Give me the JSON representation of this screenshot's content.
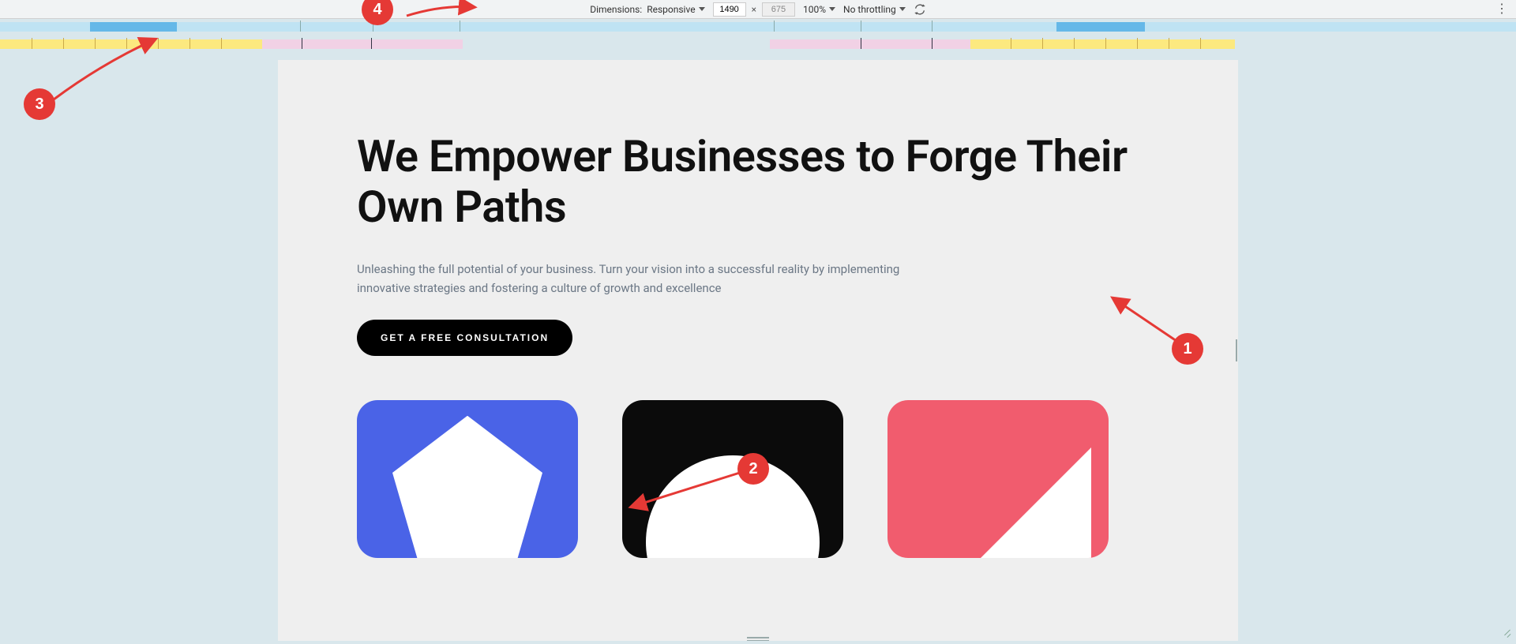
{
  "toolbar": {
    "dimensions_label": "Dimensions:",
    "dimensions_mode": "Responsive",
    "width": "1490",
    "height": "675",
    "zoom": "100%",
    "throttling": "No throttling"
  },
  "hero": {
    "title": "We Empower Businesses to Forge Their Own Paths",
    "subtitle": "Unleashing the full potential of your business. Turn your vision into a successful reality by implementing innovative strategies and fostering a culture of growth and excellence",
    "cta_label": "GET A FREE CONSULTATION"
  },
  "annotations": {
    "n1": "1",
    "n2": "2",
    "n3": "3",
    "n4": "4"
  },
  "cards": {
    "colors": {
      "blue": "#4a63e7",
      "black": "#0b0b0b",
      "red": "#f15c6e"
    }
  }
}
